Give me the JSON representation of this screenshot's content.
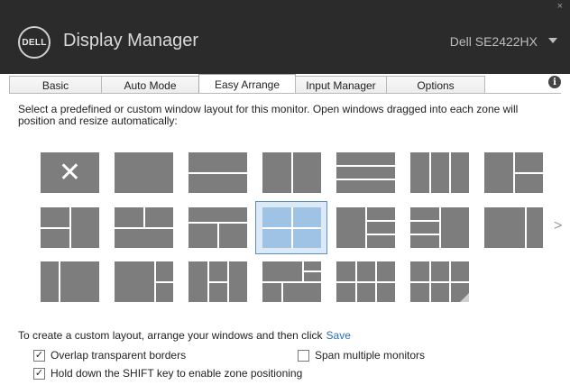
{
  "titlebar": {
    "logo_text": "DELL",
    "app_title": "Display Manager",
    "monitor_name": "Dell SE2422HX",
    "close_glyph": "×",
    "logo_icon": "dell-logo-icon",
    "dropdown_icon": "chevron-down-icon"
  },
  "tabs": [
    {
      "label": "Basic",
      "active": false
    },
    {
      "label": "Auto Mode",
      "active": false
    },
    {
      "label": "Easy Arrange",
      "active": true
    },
    {
      "label": "Input Manager",
      "active": false
    },
    {
      "label": "Options",
      "active": false
    }
  ],
  "info_icon": {
    "glyph": "i",
    "icon": "info-icon"
  },
  "description": "Select a predefined or custom window layout for this monitor.  Open windows dragged into each zone will position and resize automatically:",
  "layouts": {
    "selected": "2x2 grid",
    "next_glyph": ">",
    "clear_glyph": "✕"
  },
  "custom": {
    "text": "To create a custom layout, arrange your windows and then click",
    "save_label": "Save"
  },
  "options": {
    "overlap": {
      "label": "Overlap transparent borders",
      "checked": true
    },
    "span": {
      "label": "Span multiple monitors",
      "checked": false
    },
    "shift": {
      "label": "Hold down the SHIFT key to enable zone positioning",
      "checked": true
    }
  },
  "colors": {
    "titlebar": "#2b2b2b",
    "tile": "#7d7d7d",
    "selected_tile": "#9ec3e4",
    "link": "#2a6ebd"
  }
}
